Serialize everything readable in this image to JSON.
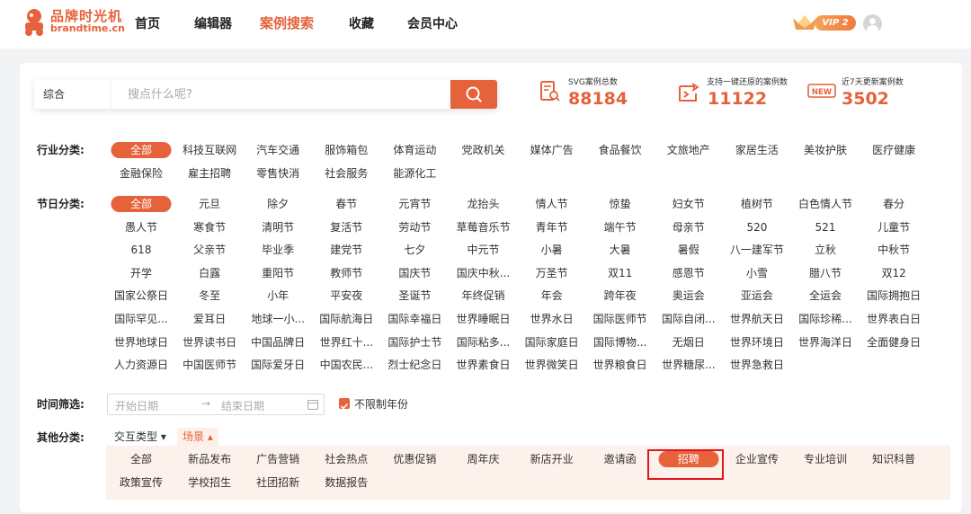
{
  "brand": {
    "name_cn": "品牌时光机",
    "name_en": "brandtime.cn"
  },
  "nav": {
    "items": [
      "首页",
      "编辑器",
      "案例搜索",
      "收藏",
      "会员中心"
    ],
    "active": "案例搜索"
  },
  "user": {
    "vip_label": "VIP 2"
  },
  "search": {
    "type": "综合",
    "placeholder": "搜点什么呢?"
  },
  "stats": [
    {
      "label": "SVG案例总数",
      "value": "88184",
      "icon": "document-search-icon"
    },
    {
      "label": "支持一键还原的案例数",
      "value": "11122",
      "icon": "restore-icon"
    },
    {
      "label": "近7天更新案例数",
      "value": "3502",
      "icon": "new-badge-icon"
    }
  ],
  "industry": {
    "label": "行业分类:",
    "tags": [
      "全部",
      "科技互联网",
      "汽车交通",
      "服饰箱包",
      "体育运动",
      "党政机关",
      "媒体广告",
      "食品餐饮",
      "文旅地产",
      "家居生活",
      "美妆护肤",
      "医疗健康",
      "金融保险",
      "雇主招聘",
      "零售快消",
      "社会服务",
      "能源化工"
    ],
    "active": "全部"
  },
  "festival": {
    "label": "节日分类:",
    "tags": [
      "全部",
      "元旦",
      "除夕",
      "春节",
      "元宵节",
      "龙抬头",
      "情人节",
      "惊蛰",
      "妇女节",
      "植树节",
      "白色情人节",
      "春分",
      "愚人节",
      "寒食节",
      "清明节",
      "复活节",
      "劳动节",
      "草莓音乐节",
      "青年节",
      "端午节",
      "母亲节",
      "520",
      "521",
      "儿童节",
      "618",
      "父亲节",
      "毕业季",
      "建党节",
      "七夕",
      "中元节",
      "小暑",
      "大暑",
      "暑假",
      "八一建军节",
      "立秋",
      "中秋节",
      "开学",
      "白露",
      "重阳节",
      "教师节",
      "国庆节",
      "国庆中秋...",
      "万圣节",
      "双11",
      "感恩节",
      "小雪",
      "腊八节",
      "双12",
      "国家公祭日",
      "冬至",
      "小年",
      "平安夜",
      "圣诞节",
      "年终促销",
      "年会",
      "跨年夜",
      "奥运会",
      "亚运会",
      "全运会",
      "国际拥抱日",
      "国际罕见...",
      "爱耳日",
      "地球一小...",
      "国际航海日",
      "国际幸福日",
      "世界睡眠日",
      "世界水日",
      "国际医师节",
      "国际自闭...",
      "世界航天日",
      "国际珍稀...",
      "世界表白日",
      "世界地球日",
      "世界读书日",
      "中国品牌日",
      "世界红十...",
      "国际护士节",
      "国际粘多...",
      "国际家庭日",
      "国际博物...",
      "无烟日",
      "世界环境日",
      "世界海洋日",
      "全面健身日",
      "人力资源日",
      "中国医师节",
      "国际爱牙日",
      "中国农民...",
      "烈士纪念日",
      "世界素食日",
      "世界微笑日",
      "世界粮食日",
      "世界糖尿...",
      "世界急救日"
    ],
    "active": "全部"
  },
  "time": {
    "label": "时间筛选:",
    "start_placeholder": "开始日期",
    "sep": "→",
    "end_placeholder": "结束日期",
    "no_limit_label": "不限制年份",
    "no_limit_checked": true
  },
  "other": {
    "label": "其他分类:",
    "sub_tabs": [
      "交互类型 ▾",
      "场景 ▴"
    ],
    "active_sub_tab": "场景 ▴",
    "tags": [
      "全部",
      "新品发布",
      "广告营销",
      "社会热点",
      "优惠促销",
      "周年庆",
      "新店开业",
      "邀请函",
      "招聘",
      "企业宣传",
      "专业培训",
      "知识科普",
      "政策宣传",
      "学校招生",
      "社团招新",
      "数据报告"
    ],
    "active": "招聘"
  },
  "colors": {
    "accent": "#e5623b",
    "highlight_border": "#e3151c",
    "scene_bg": "#fdf1ec"
  }
}
